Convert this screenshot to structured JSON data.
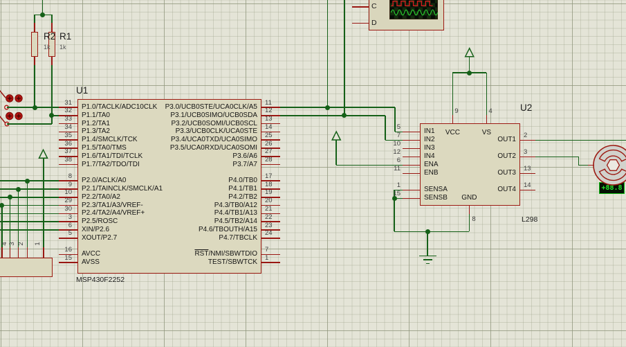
{
  "schematic": {
    "resistors": [
      {
        "ref": "R2",
        "value": "1k"
      },
      {
        "ref": "R1",
        "value": "1k"
      }
    ],
    "u1": {
      "ref": "U1",
      "part": "MSP430F2252",
      "left_pins": [
        {
          "n": "31",
          "name": "P1.0/TACLK/ADC10CLK",
          "row": 0
        },
        {
          "n": "32",
          "name": "P1.1/TA0",
          "row": 1
        },
        {
          "n": "33",
          "name": "P1.2/TA1",
          "row": 2
        },
        {
          "n": "34",
          "name": "P1.3/TA2",
          "row": 3
        },
        {
          "n": "35",
          "name": "P1.4/SMCLK/TCK",
          "row": 4
        },
        {
          "n": "36",
          "name": "P1.5/TA0/TMS",
          "row": 5
        },
        {
          "n": "37",
          "name": "P1.6/TA1/TDI/TCLK",
          "row": 6
        },
        {
          "n": "38",
          "name": "P1.7/TA2/TDO/TDI",
          "row": 7
        },
        {
          "n": "8",
          "name": "P2.0/ACLK/A0",
          "row": 9
        },
        {
          "n": "9",
          "name": "P2.1/TAINCLK/SMCLK/A1",
          "row": 10
        },
        {
          "n": "10",
          "name": "P2.2/TA0/A2",
          "row": 11
        },
        {
          "n": "29",
          "name": "P2.3/TA1/A3/VREF-",
          "row": 12
        },
        {
          "n": "30",
          "name": "P2.4/TA2/A4/VREF+",
          "row": 13
        },
        {
          "n": "3",
          "name": "P2.5/ROSC",
          "row": 14
        },
        {
          "n": "6",
          "name": "XIN/P2.6",
          "row": 15
        },
        {
          "n": "5",
          "name": "XOUT/P2.7",
          "row": 16
        },
        {
          "n": "16",
          "name": "AVCC",
          "row": 18
        },
        {
          "n": "15",
          "name": "AVSS",
          "row": 19
        }
      ],
      "right_pins": [
        {
          "n": "11",
          "name": "P3.0/UCB0STE/UCA0CLK/A5",
          "row": 0
        },
        {
          "n": "12",
          "name": "P3.1/UCB0SIMO/UCB0SDA",
          "row": 1
        },
        {
          "n": "13",
          "name": "P3.2/UCB0SOMI/UCB0SCL",
          "row": 2
        },
        {
          "n": "14",
          "name": "P3.3/UCB0CLK/UCA0STE",
          "row": 3
        },
        {
          "n": "25",
          "name": "P3.4/UCA0TXD/UCA0SIMO",
          "row": 4
        },
        {
          "n": "26",
          "name": "P3.5/UCA0RXD/UCA0SOMI",
          "row": 5
        },
        {
          "n": "27",
          "name": "P3.6/A6",
          "row": 6
        },
        {
          "n": "28",
          "name": "P3.7/A7",
          "row": 7
        },
        {
          "n": "17",
          "name": "P4.0/TB0",
          "row": 9
        },
        {
          "n": "18",
          "name": "P4.1/TB1",
          "row": 10
        },
        {
          "n": "19",
          "name": "P4.2/TB2",
          "row": 11
        },
        {
          "n": "20",
          "name": "P4.3/TB0/A12",
          "row": 12
        },
        {
          "n": "21",
          "name": "P4.4/TB1/A13",
          "row": 13
        },
        {
          "n": "22",
          "name": "P4.5/TB2/A14",
          "row": 14
        },
        {
          "n": "23",
          "name": "P4.6/TBOUTH/A15",
          "row": 15
        },
        {
          "n": "24",
          "name": "P4.7/TBCLK",
          "row": 16
        },
        {
          "n": "7",
          "name": "RST/NMI/SBWTDIO",
          "row": 18,
          "ol": "RST"
        },
        {
          "n": "1",
          "name": "TEST/SBWTCK",
          "row": 19
        }
      ]
    },
    "u2": {
      "ref": "U2",
      "part": "L298",
      "left_pins": [
        {
          "n": "5",
          "name": "IN1",
          "row": 0
        },
        {
          "n": "7",
          "name": "IN2",
          "row": 1
        },
        {
          "n": "10",
          "name": "IN3",
          "row": 2
        },
        {
          "n": "12",
          "name": "IN4",
          "row": 3
        },
        {
          "n": "6",
          "name": "ENA",
          "row": 4
        },
        {
          "n": "11",
          "name": "ENB",
          "row": 5
        },
        {
          "n": "1",
          "name": "SENSA",
          "row": 7
        },
        {
          "n": "15",
          "name": "SENSB",
          "row": 8
        }
      ],
      "right_pins": [
        {
          "n": "2",
          "name": "OUT1",
          "row": 1
        },
        {
          "n": "3",
          "name": "OUT2",
          "row": 3
        },
        {
          "n": "13",
          "name": "OUT3",
          "row": 5
        },
        {
          "n": "14",
          "name": "OUT4",
          "row": 7
        }
      ],
      "top_pins": [
        {
          "n": "9",
          "name": "VCC"
        },
        {
          "n": "4",
          "name": "VS"
        }
      ],
      "bottom_pins": [
        {
          "n": "8",
          "name": "GND"
        }
      ]
    },
    "connector": {
      "pins": [
        "4",
        "3",
        "2",
        "1"
      ]
    },
    "oscilloscope": {
      "channels": [
        "C",
        "D"
      ]
    },
    "motor": {
      "display": "+88.8"
    }
  },
  "colors": {
    "wire_green": "#156018",
    "pin_red": "#991712",
    "component_fill": "#dcd9bf",
    "component_border": "#9c1a12",
    "display_text": "#2ae42e"
  }
}
